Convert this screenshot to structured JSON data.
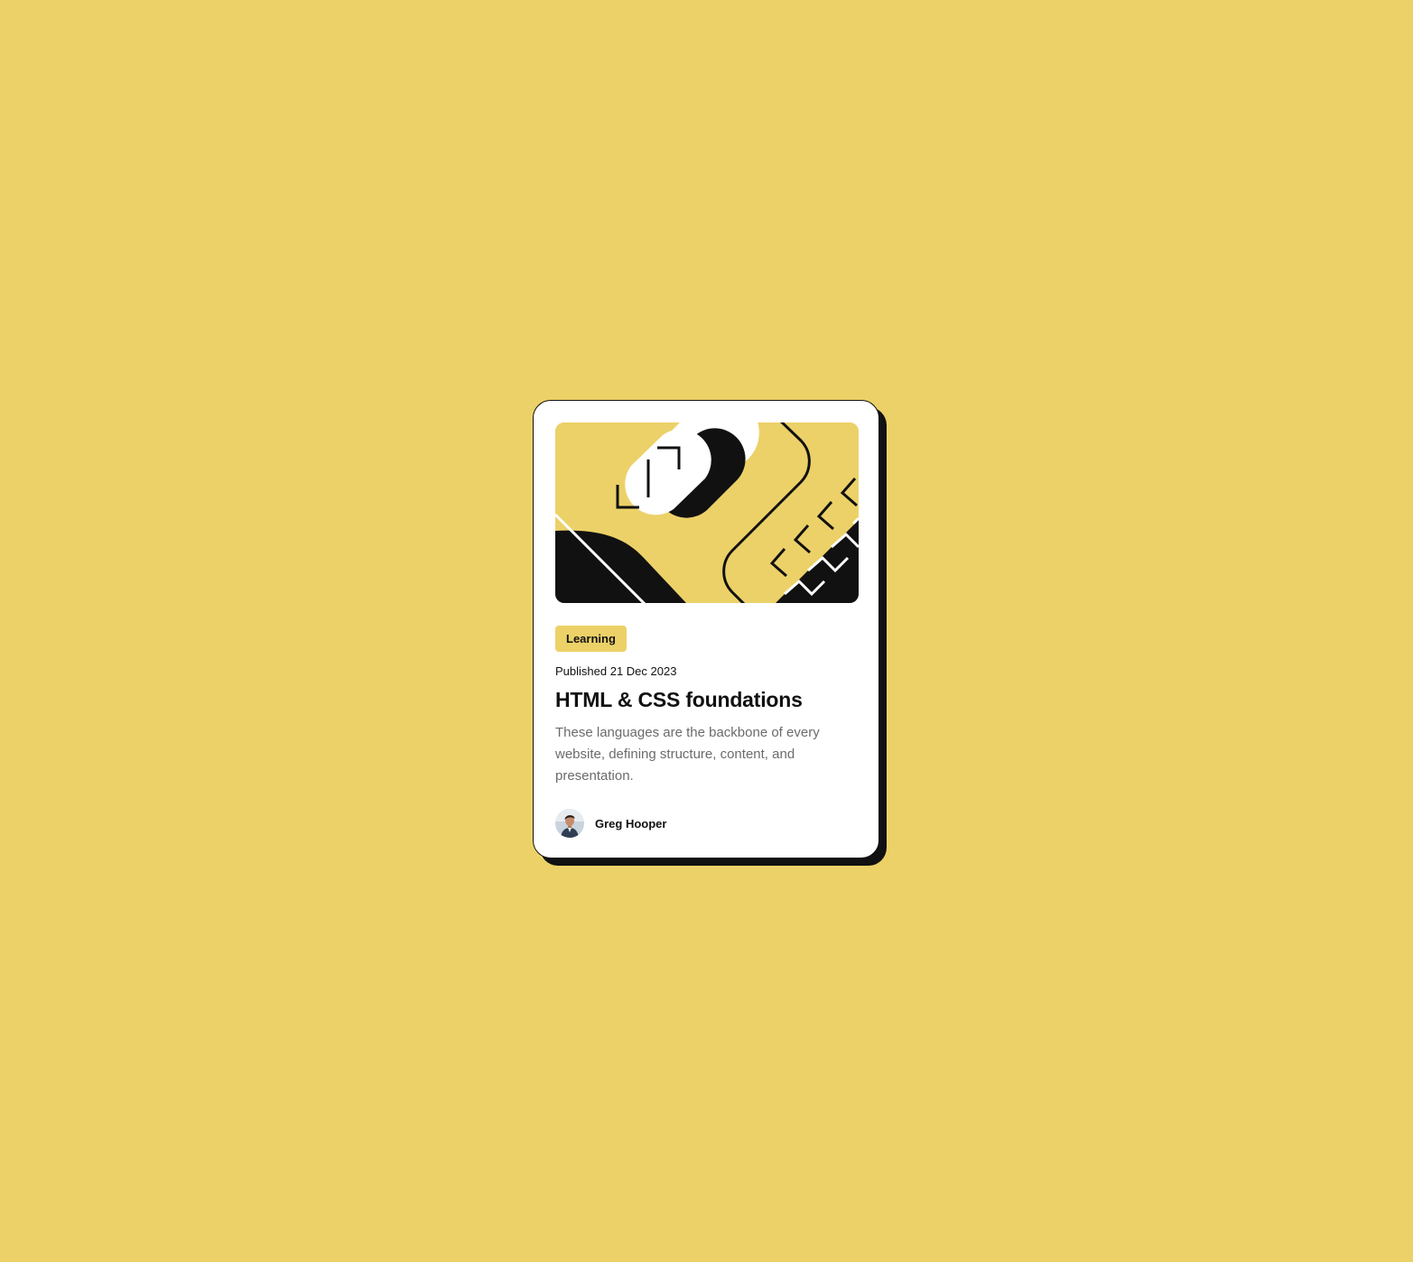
{
  "card": {
    "badge": "Learning",
    "date": "Published 21 Dec 2023",
    "title": "HTML & CSS foundations",
    "description": "These languages are the backbone of every website, defining structure, content, and presentation.",
    "author": {
      "name": "Greg Hooper",
      "avatar_icon": "user-avatar"
    },
    "hero_icon": "code-brackets-illustration"
  },
  "colors": {
    "background": "#ecd168",
    "card": "#ffffff",
    "ink": "#111111",
    "muted_text": "#6b6b6b"
  }
}
